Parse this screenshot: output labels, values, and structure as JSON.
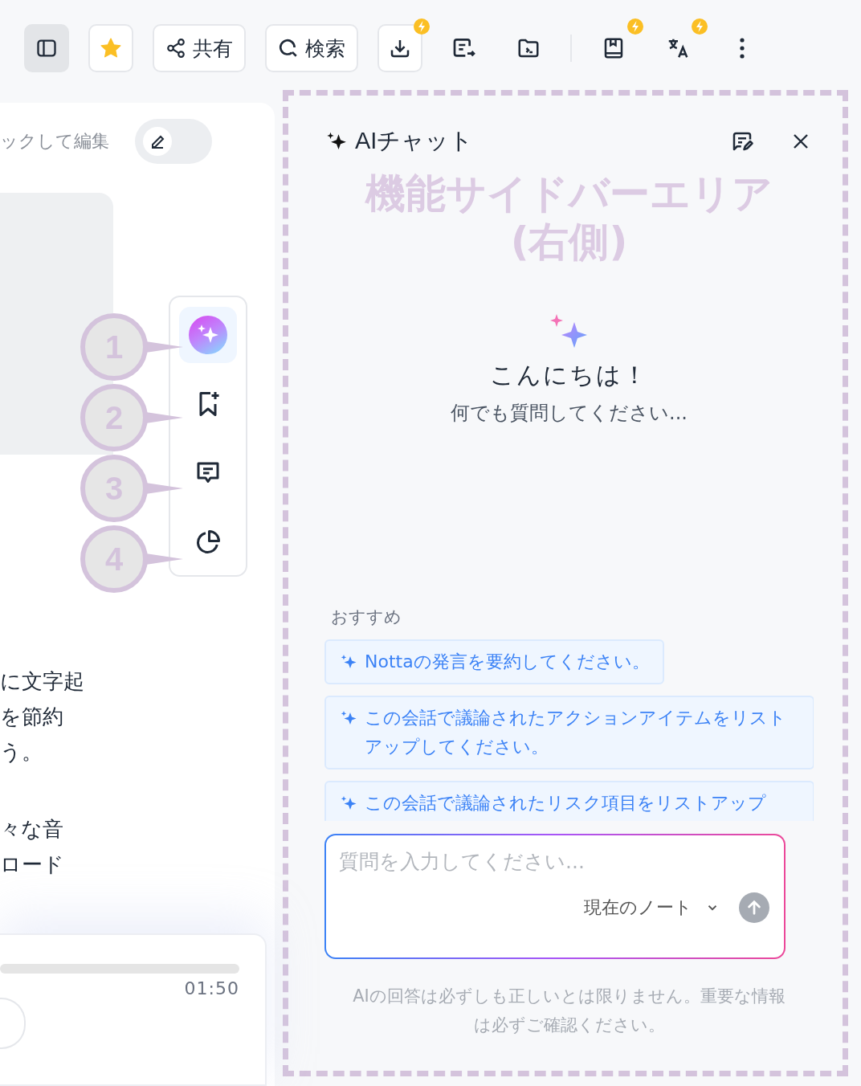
{
  "toolbar": [
    {
      "kind": "panel",
      "on": true
    },
    {
      "kind": "star"
    },
    {
      "kind": "share",
      "label": "共有"
    },
    {
      "kind": "search",
      "label": "検索"
    },
    {
      "kind": "download",
      "premium": true
    },
    {
      "kind": "export"
    },
    {
      "kind": "folder"
    },
    {
      "kind": "divider"
    },
    {
      "kind": "save",
      "premium": true
    },
    {
      "kind": "translate",
      "premium": true
    },
    {
      "kind": "more"
    }
  ],
  "note": {
    "edit_hint": "ックして編集",
    "edit_mode": false,
    "paragraphs": [
      [
        "に文字起",
        "を節約",
        "う。"
      ],
      [
        "々な音",
        "ロード"
      ]
    ],
    "side_tools": [
      {
        "kind": "ai",
        "selected": true,
        "callout": "1"
      },
      {
        "kind": "bookmark",
        "selected": false,
        "callout": "2"
      },
      {
        "kind": "comment",
        "selected": false,
        "callout": "3"
      },
      {
        "kind": "chart",
        "selected": false,
        "callout": "4"
      }
    ],
    "player": {
      "time": "01:50"
    }
  },
  "chat": {
    "title": "AIチャット",
    "area_label": "機能サイドバーエリア\n(右側)",
    "greeting": "こんにちは！",
    "prompt": "何でも質問してください...",
    "suggestions_label": "おすすめ",
    "suggestions": [
      "Nottaの発言を要約してください。",
      "この会話で議論されたアクションアイテムをリストアップしてください。",
      "この会話で議論されたリスク項目をリストアップ"
    ],
    "input": {
      "placeholder": "質問を入力してください...",
      "scope": "現在のノート"
    },
    "disclaimer": "AIの回答は必ずしも正しいとは限りません。重要な情報は必ずご確認ください。"
  }
}
